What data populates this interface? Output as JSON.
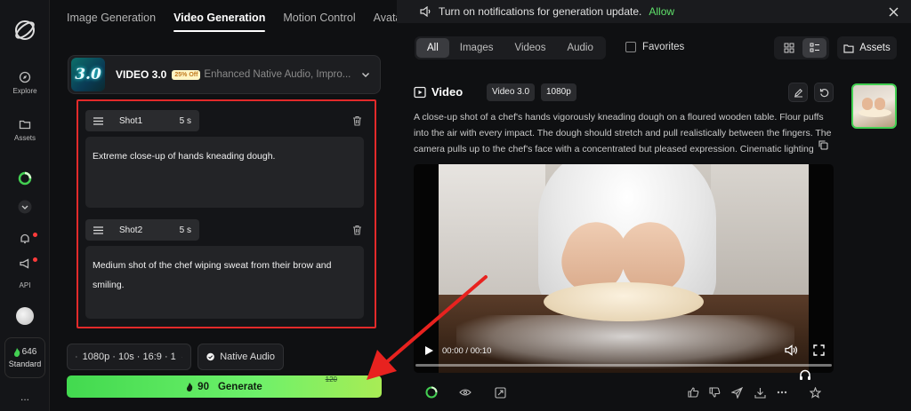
{
  "rail": {
    "explore": "Explore",
    "assets": "Assets",
    "api": "API",
    "credits": "646",
    "plan": "Standard",
    "more": "..."
  },
  "tabs": [
    "Image Generation",
    "Video Generation",
    "Motion Control",
    "Avatar"
  ],
  "model": {
    "thumb_text": "3.0",
    "name": "VIDEO 3.0",
    "discount": "25% Off",
    "description": "Enhanced Native Audio, Impro..."
  },
  "shots": [
    {
      "label": "Shot1",
      "duration": "5 s",
      "text": "Extreme close-up of hands kneading dough."
    },
    {
      "label": "Shot2",
      "duration": "5 s",
      "text": "Medium shot of the chef wiping sweat from their brow and smiling."
    }
  ],
  "controls": {
    "settings": "1080p · 10s · 16:9 · 1",
    "native_audio": "Native Audio",
    "generate_cost": "90",
    "generate_label": "Generate",
    "old_cost": "120"
  },
  "notice": {
    "text": "Turn on notifications for generation update.",
    "allow": "Allow"
  },
  "filters": [
    "All",
    "Images",
    "Videos",
    "Audio"
  ],
  "favorites": "Favorites",
  "assets_button": "Assets",
  "video": {
    "title": "Video",
    "chips": [
      "Video 3.0",
      "1080p"
    ],
    "prompt": "A close-up shot of a chef's hands vigorously kneading dough on a floured wooden table. Flour puffs into the air with every impact. The dough should stretch and pull realistically between the fingers. The camera pulls up to the chef's face with a concentrated but pleased expression. Cinematic lighting",
    "time": "00:00 / 00:10",
    "progress": 0
  },
  "colors": {
    "accent_green": "#43cf52",
    "highlight_red": "#e22a2a"
  }
}
